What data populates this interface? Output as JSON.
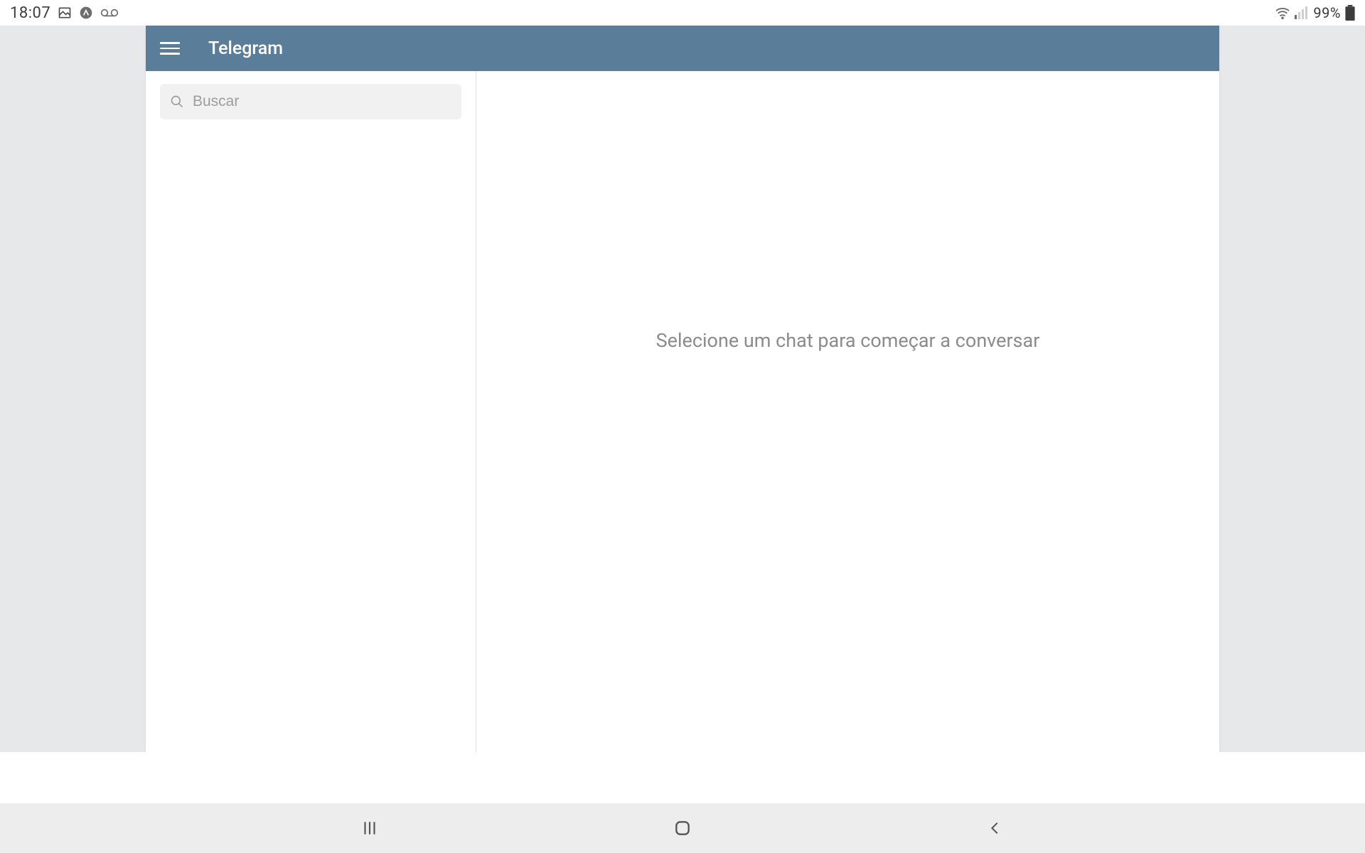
{
  "status": {
    "time": "18:07",
    "battery_pct": "99%"
  },
  "header": {
    "title": "Telegram"
  },
  "search": {
    "placeholder": "Buscar"
  },
  "main": {
    "empty_message": "Selecione um chat para começar a conversar"
  }
}
